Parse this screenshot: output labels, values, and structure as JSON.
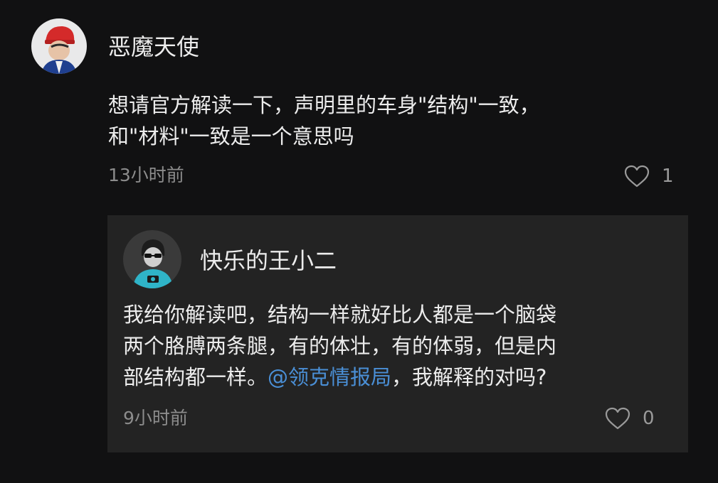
{
  "comment": {
    "username": "恶魔天使",
    "text_lines": [
      "想请官方解读一下，声明里的车身\"结构\"一致，",
      "和\"材料\"一致是一个意思吗"
    ],
    "time": "13小时前",
    "likes": "1",
    "like_icon": "heart-outline-icon"
  },
  "reply": {
    "username": "快乐的王小二",
    "text_lines": [
      "我给你解读吧，结构一样就好比人都是一个脑袋",
      "两个胳膊两条腿，有的体壮，有的体弱，但是内"
    ],
    "text_line3_before": "部结构都一样。",
    "mention": "@领克情报局",
    "text_line3_after": "，我解释的对吗?",
    "time": "9小时前",
    "likes": "0",
    "like_icon": "heart-outline-icon"
  },
  "colors": {
    "background": "#111112",
    "reply_background": "#232323",
    "text": "#ececec",
    "meta": "#8c8c8c",
    "mention": "#4a8fd6"
  }
}
